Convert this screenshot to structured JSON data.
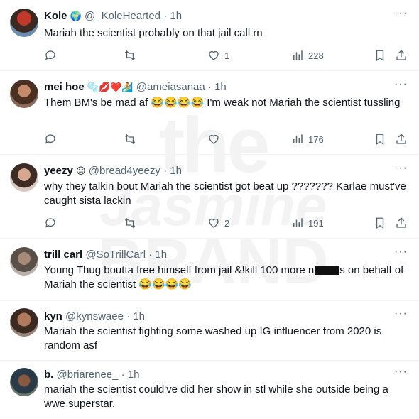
{
  "watermark": {
    "line1": "the",
    "line2": "Jasmine",
    "line3": "BRAND"
  },
  "tweets": [
    {
      "name": "Kole",
      "badges": "🌍",
      "handle": "@_KoleHearted",
      "time": "· 1h",
      "text": "Mariah the scientist probably on that jail call rn",
      "replies": "",
      "retweets": "",
      "likes": "1",
      "views": "228"
    },
    {
      "name": "mei hoe",
      "badges": "🫧💋❤️🏄",
      "handle": "@ameiasanaa",
      "time": "· 1h",
      "text": "Them BM's be mad af 😂😂😂😂 I'm weak not Mariah the scientist tussling",
      "replies": "",
      "retweets": "",
      "likes": "",
      "views": "176"
    },
    {
      "name": "yeezy",
      "badges": "😐",
      "handle": "@bread4yeezy",
      "time": "· 1h",
      "text": "why they talkin bout Mariah the scientist got beat up ??????? Karlae must've caught sista lackin",
      "replies": "",
      "retweets": "",
      "likes": "2",
      "views": "191"
    },
    {
      "name": "trill carl",
      "badges": "",
      "handle": "@SoTrillCarl",
      "time": "· 1h",
      "text_a": "Young Thug boutta free himself from jail &!kill 100 more n",
      "text_b": "s on behalf of Mariah the scientist 😂😂😂😂"
    },
    {
      "name": "kyn",
      "badges": "",
      "handle": "@kynswaee",
      "time": "· 1h",
      "text": "Mariah the scientist fighting some washed up IG influencer from 2020 is random asf"
    },
    {
      "name": "b.",
      "badges": "",
      "handle": "@briarenee_",
      "time": "· 1h",
      "text": "mariah the scientist could've did her show in stl while she outside being a wwe superstar."
    }
  ],
  "colors": {
    "accent": "#0f1419",
    "muted": "#536471",
    "separator": "#eff3f4"
  }
}
